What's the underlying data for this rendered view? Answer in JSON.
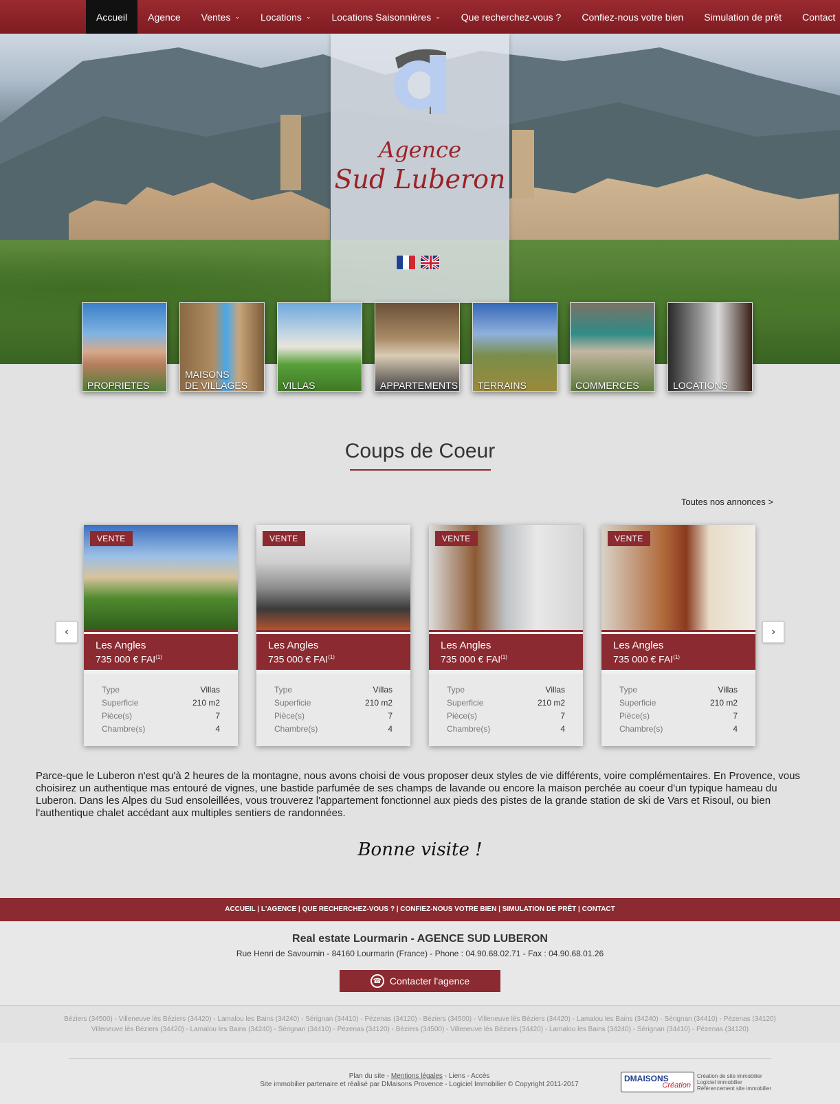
{
  "nav": {
    "items": [
      {
        "label": "Accueil",
        "dropdown": false,
        "active": true
      },
      {
        "label": "Agence",
        "dropdown": false
      },
      {
        "label": "Ventes",
        "dropdown": true
      },
      {
        "label": "Locations",
        "dropdown": true
      },
      {
        "label": "Locations Saisonnières",
        "dropdown": true
      },
      {
        "label": "Que recherchez-vous ?",
        "dropdown": false
      },
      {
        "label": "Confiez-nous votre bien",
        "dropdown": false
      },
      {
        "label": "Simulation de prêt",
        "dropdown": false
      },
      {
        "label": "Contact",
        "dropdown": false
      }
    ]
  },
  "logo": {
    "line1": "Agence",
    "line2": "Sud Luberon"
  },
  "categories": [
    {
      "label": "PROPRIETES"
    },
    {
      "label": "MAISONS\nDE VILLAGES"
    },
    {
      "label": "VILLAS"
    },
    {
      "label": "APPARTEMENTS"
    },
    {
      "label": "TERRAINS"
    },
    {
      "label": "COMMERCES"
    },
    {
      "label": "LOCATIONS"
    }
  ],
  "section": {
    "title": "Coups de Coeur",
    "all_link": "Toutes nos annonces >"
  },
  "cards": [
    {
      "badge": "VENTE",
      "city": "Les Angles",
      "price": "735 000 € FAI",
      "price_note": "(1)",
      "specs": [
        {
          "k": "Type",
          "v": "Villas"
        },
        {
          "k": "Superficie",
          "v": "210 m2"
        },
        {
          "k": "Pièce(s)",
          "v": "7"
        },
        {
          "k": "Chambre(s)",
          "v": "4"
        }
      ]
    },
    {
      "badge": "VENTE",
      "city": "Les Angles",
      "price": "735 000 € FAI",
      "price_note": "(1)",
      "specs": [
        {
          "k": "Type",
          "v": "Villas"
        },
        {
          "k": "Superficie",
          "v": "210 m2"
        },
        {
          "k": "Pièce(s)",
          "v": "7"
        },
        {
          "k": "Chambre(s)",
          "v": "4"
        }
      ]
    },
    {
      "badge": "VENTE",
      "city": "Les Angles",
      "price": "735 000 € FAI",
      "price_note": "(1)",
      "specs": [
        {
          "k": "Type",
          "v": "Villas"
        },
        {
          "k": "Superficie",
          "v": "210 m2"
        },
        {
          "k": "Pièce(s)",
          "v": "7"
        },
        {
          "k": "Chambre(s)",
          "v": "4"
        }
      ]
    },
    {
      "badge": "VENTE",
      "city": "Les Angles",
      "price": "735 000 € FAI",
      "price_note": "(1)",
      "specs": [
        {
          "k": "Type",
          "v": "Villas"
        },
        {
          "k": "Superficie",
          "v": "210 m2"
        },
        {
          "k": "Pièce(s)",
          "v": "7"
        },
        {
          "k": "Chambre(s)",
          "v": "4"
        }
      ]
    }
  ],
  "intro": "Parce-que le Luberon n'est qu'à 2 heures de la montagne, nous avons choisi de vous proposer deux styles de vie différents, voire complémentaires. En Provence, vous choisirez un authentique mas entouré de vignes, une bastide parfumée de ses champs de lavande ou encore la maison perchée au coeur d'un typique hameau du Luberon. Dans les Alpes du Sud ensoleillées, vous trouverez l'appartement fonctionnel aux pieds des pistes de la grande station de ski de Vars et Risoul, ou bien l'authentique chalet accédant aux multiples sentiers de randonnées.",
  "bonne_visite": "Bonne visite !",
  "footer": {
    "links": [
      "ACCUEIL",
      "L'AGENCE",
      "QUE RECHERCHEZ-VOUS ?",
      "CONFIEZ-NOUS VOTRE BIEN",
      "SIMULATION DE PRÊT",
      "CONTACT"
    ],
    "agency_name": "Real estate Lourmarin - AGENCE SUD LUBERON",
    "address": "Rue Henri de Savournin - 84160 Lourmarin (France) - Phone : 04.90.68.02.71 - Fax : 04.90.68.01.26",
    "contact_button": "Contacter l'agence",
    "towns_line1": "Béziers (34500) - Villeneuve lès Béziers (34420) - Lamalou les Bains (34240) - Sérignan (34410) - Pézenas (34120) - Béziers (34500) - Villeneuve lès Béziers (34420) - Lamalou les Bains (34240) - Sérignan (34410) - Pézenas (34120)",
    "towns_line2": "Villeneuve lès Béziers (34420) - Lamalou les Bains (34240) - Sérignan (34410) - Pézenas (34120) - Béziers (34500) - Villeneuve lès Béziers (34420) - Lamalou les Bains (34240) - Sérignan (34410) - Pézenas (34120)",
    "bottom_plan": "Plan du site",
    "bottom_mentions": "Mentions légales",
    "bottom_liens": "Liens",
    "bottom_acces": "Accès",
    "bottom_credit": "Site immobilier partenaire et réalisé par DMaisons Provence - Logiciel Immobilier © Copyright 2011-2017",
    "dm_brand": "DMAISONS",
    "dm_sub": "Création",
    "dm_line1": "Création de site immobilier",
    "dm_line2": "Logiciel immobilier",
    "dm_line3": "Référencement site immobilier"
  }
}
